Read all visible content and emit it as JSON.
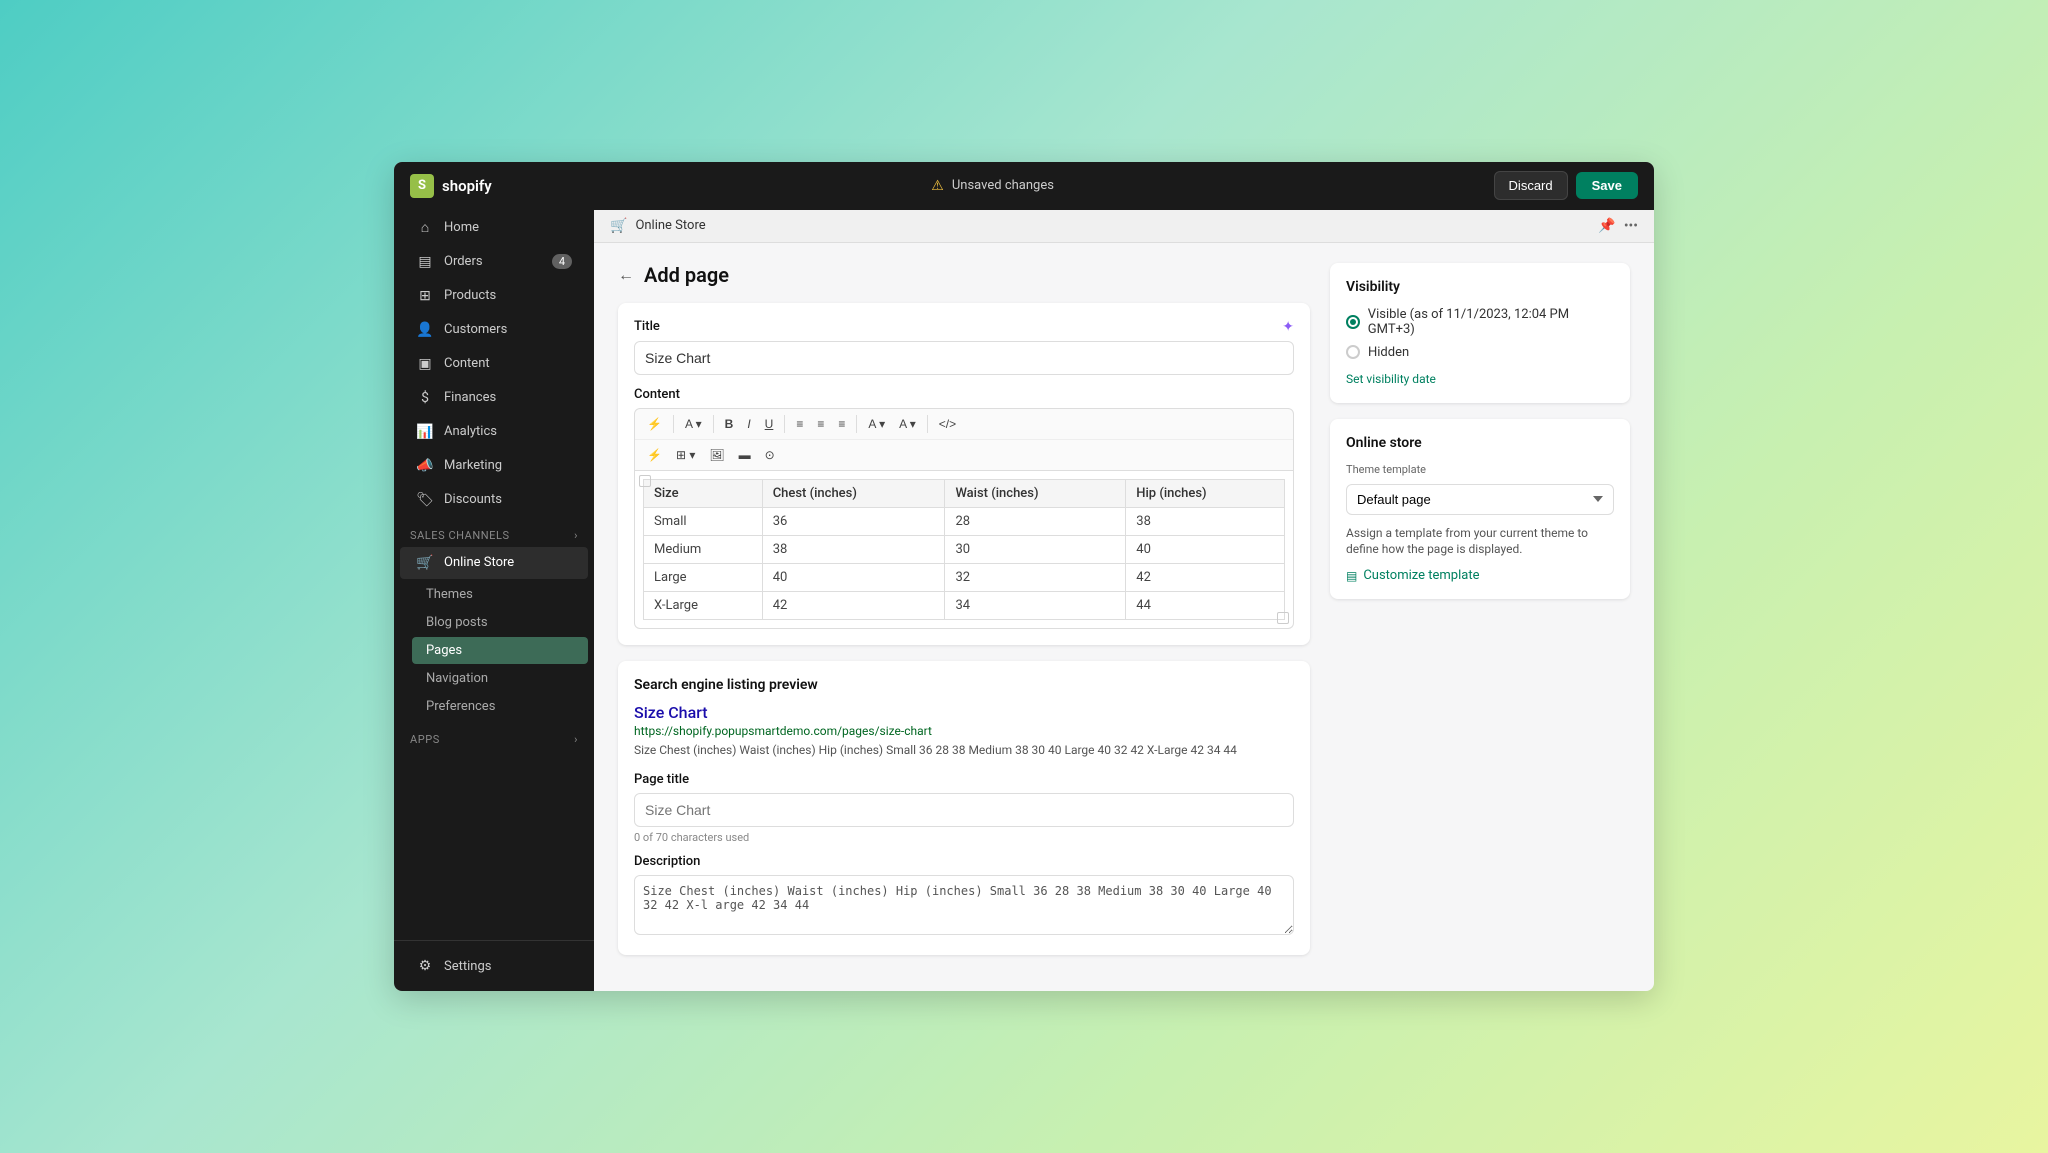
{
  "topbar": {
    "logo_text": "shopify",
    "unsaved_label": "Unsaved changes",
    "discard_label": "Discard",
    "save_label": "Save"
  },
  "sidebar": {
    "home_label": "Home",
    "orders_label": "Orders",
    "orders_badge": "4",
    "products_label": "Products",
    "customers_label": "Customers",
    "content_label": "Content",
    "finances_label": "Finances",
    "analytics_label": "Analytics",
    "marketing_label": "Marketing",
    "discounts_label": "Discounts",
    "sales_channels_label": "Sales channels",
    "online_store_label": "Online Store",
    "themes_label": "Themes",
    "blog_posts_label": "Blog posts",
    "pages_label": "Pages",
    "navigation_label": "Navigation",
    "preferences_label": "Preferences",
    "apps_label": "Apps",
    "settings_label": "Settings"
  },
  "secondary_nav": {
    "breadcrumb": "Online Store"
  },
  "page": {
    "title": "Add page",
    "title_field_label": "Title",
    "title_value": "Size Chart",
    "content_label": "Content",
    "table": {
      "headers": [
        "Size",
        "Chest (inches)",
        "Waist (inches)",
        "Hip (inches)"
      ],
      "rows": [
        [
          "Small",
          "36",
          "28",
          "38"
        ],
        [
          "Medium",
          "38",
          "30",
          "40"
        ],
        [
          "Large",
          "40",
          "32",
          "42"
        ],
        [
          "X-Large",
          "42",
          "34",
          "44"
        ]
      ]
    }
  },
  "seo": {
    "section_label": "Search engine listing preview",
    "title_preview": "Size Chart",
    "url_preview": "https://shopify.popupsmartdemo.com/pages/size-chart",
    "desc_preview": "Size Chest (inches) Waist (inches) Hip (inches) Small 36 28 38 Medium 38 30 40 Large 40 32 42 X-Large 42 34 44",
    "page_title_label": "Page title",
    "page_title_placeholder": "Size Chart",
    "char_count": "0 of 70 characters used",
    "description_label": "Description",
    "description_value": "Size Chest (inches) Waist (inches) Hip (inches) Small 36 28 38 Medium 38 30 40 Large 40 32 42 X-l arge 42 34 44"
  },
  "visibility_panel": {
    "heading": "Visibility",
    "visible_label": "Visible (as of 11/1/2023, 12:04 PM GMT+3)",
    "hidden_label": "Hidden",
    "set_visibility_label": "Set visibility date"
  },
  "online_store_panel": {
    "heading": "Online store",
    "theme_template_label": "Theme template",
    "theme_template_value": "Default page",
    "assign_text": "Assign a template from your current theme to define how the page is displayed.",
    "customize_label": "Customize template"
  }
}
